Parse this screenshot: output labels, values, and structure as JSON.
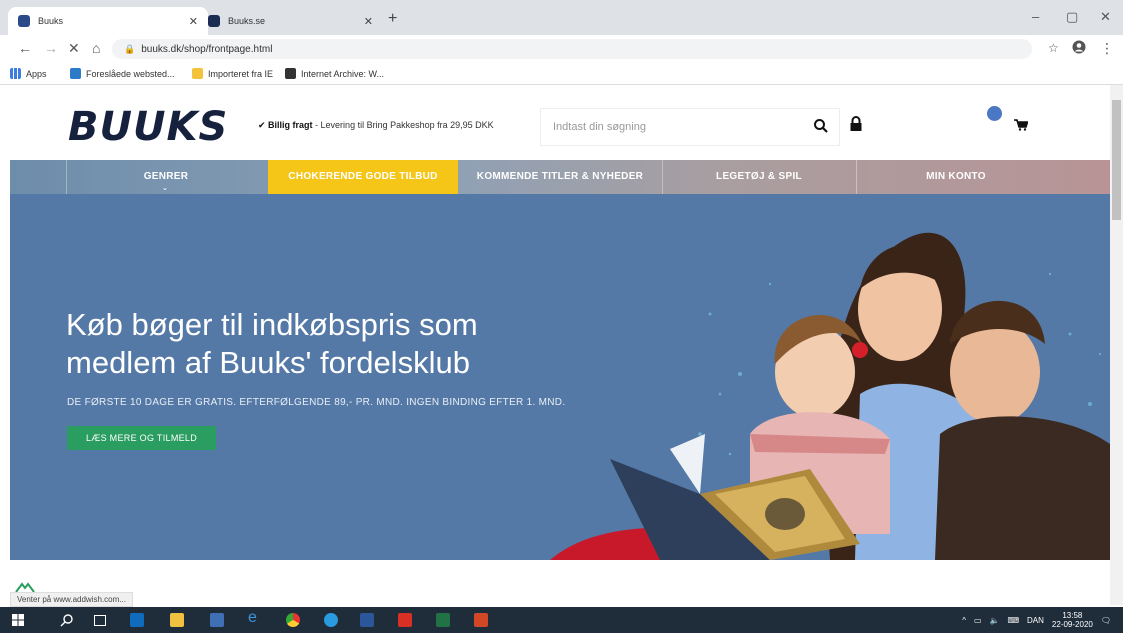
{
  "browser": {
    "tabs": [
      {
        "title": "Buuks",
        "active": true
      },
      {
        "title": "Buuks.se",
        "active": false
      }
    ],
    "url": "buuks.dk/shop/frontpage.html",
    "bookmarks": [
      "Apps",
      "Foreslåede websted...",
      "Importeret fra IE",
      "Internet Archive: W..."
    ]
  },
  "site": {
    "logo": "BUUKS",
    "freight_bold": "✔ Billig fragt",
    "freight_text": " - Levering til Bring Pakkeshop fra 29,95 DKK",
    "search_placeholder": "Indtast din søgning"
  },
  "nav": {
    "items": [
      "GENRER",
      "CHOKERENDE GODE TILBUD",
      "KOMMENDE TITLER & NYHEDER",
      "LEGETØJ & SPIL",
      "MIN KONTO"
    ]
  },
  "hero": {
    "title_line1": "Køb bøger til indkøbspris som",
    "title_line2": "medlem af Buuks' fordelsklub",
    "subtitle": "DE FØRSTE 10 DAGE ER GRATIS. EFTERFØLGENDE 89,- PR. MND. INGEN BINDING EFTER 1. MND.",
    "button": "LÆS MERE OG TILMELD"
  },
  "status_text": "Venter på www.addwish.com...",
  "taskbar": {
    "lang": "DAN",
    "time": "13:58",
    "date": "22-09-2020"
  },
  "colors": {
    "hero_bg": "#5479a6",
    "promo": "#f5c518",
    "cta": "#2a9d60",
    "logo": "#16213e"
  }
}
